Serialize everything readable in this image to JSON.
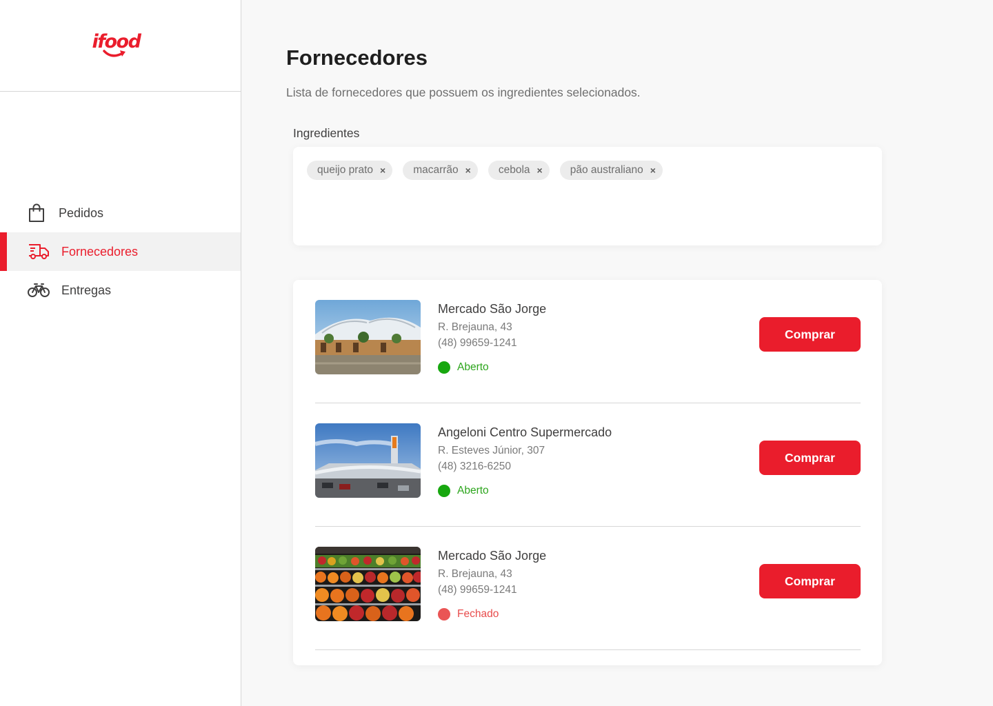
{
  "brand": {
    "logo_text": "ifood",
    "accent": "#ea1d2c"
  },
  "sidebar": {
    "items": [
      {
        "label": "Pedidos",
        "icon": "shopping-bag-icon",
        "active": false
      },
      {
        "label": "Fornecedores",
        "icon": "truck-icon",
        "active": true
      },
      {
        "label": "Entregas",
        "icon": "bicycle-icon",
        "active": false
      }
    ]
  },
  "main": {
    "title": "Fornecedores",
    "subtitle": "Lista de fornecedores que possuem os ingredientes selecionados.",
    "ingredients_label": "Ingredientes",
    "ingredients": [
      "queijo prato",
      "macarrão",
      "cebola",
      "pão australiano"
    ],
    "chip_remove_glyph": "×",
    "suppliers": [
      {
        "name": "Mercado São Jorge",
        "address": "R. Brejauna, 43",
        "phone": "(48) 99659-1241",
        "status": "Aberto",
        "status_color": "#17a70f",
        "image": "market-building-photo",
        "button": "Comprar"
      },
      {
        "name": "Angeloni Centro Supermercado",
        "address": "R. Esteves Júnior, 307",
        "phone": "(48) 3216-6250",
        "status": "Aberto",
        "status_color": "#17a70f",
        "image": "supermarket-building-photo",
        "button": "Comprar"
      },
      {
        "name": "Mercado São Jorge",
        "address": "R. Brejauna, 43",
        "phone": "(48) 99659-1241",
        "status": "Fechado",
        "status_color": "#ea5555",
        "image": "produce-shelves-photo",
        "button": "Comprar"
      }
    ]
  }
}
